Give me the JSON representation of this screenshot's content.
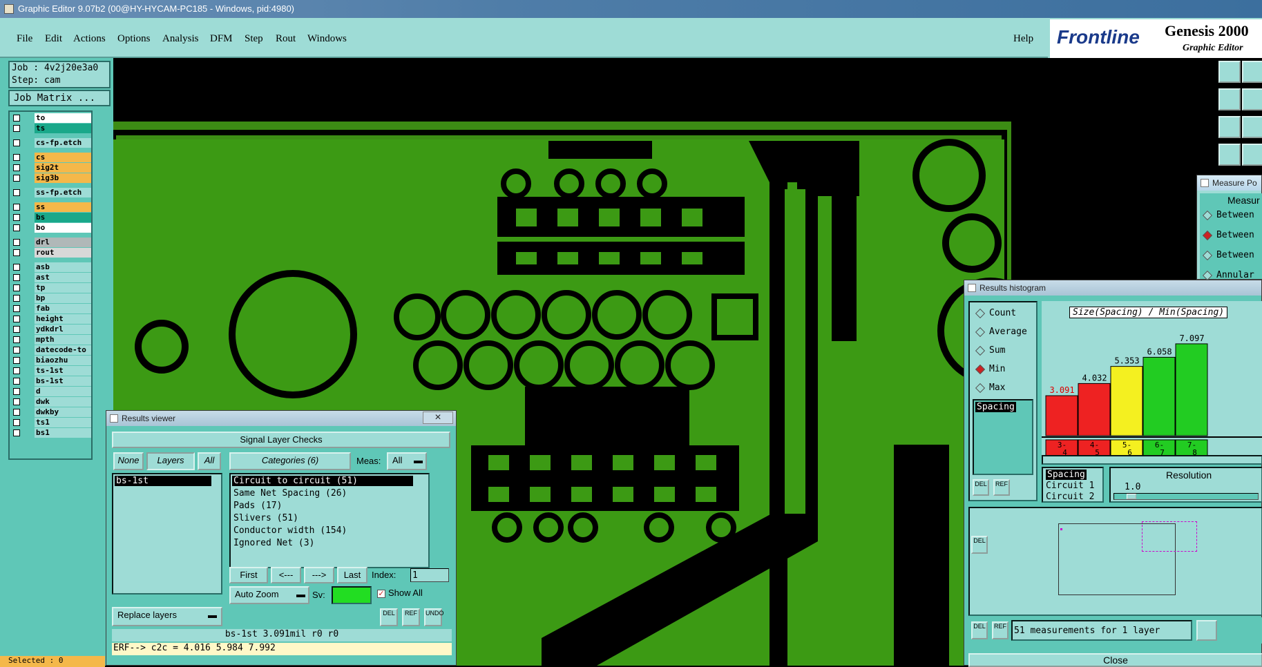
{
  "window_title": "Graphic Editor 9.07b2 (00@HY-HYCAM-PC185 - Windows, pid:4980)",
  "menu": [
    "File",
    "Edit",
    "Actions",
    "Options",
    "Analysis",
    "DFM",
    "Step",
    "Rout",
    "Windows"
  ],
  "help": "Help",
  "brand": {
    "logo": "Frontline",
    "product": "Genesis 2000",
    "subtitle": "Graphic Editor"
  },
  "job": {
    "job_line": "Job : 4v2j20e3a0",
    "step_line": "Step: cam",
    "matrix_button": "Job Matrix ..."
  },
  "layers": [
    {
      "name": "to",
      "color": "#ffffff"
    },
    {
      "name": "ts",
      "color": "#1aa88a"
    },
    {
      "name": "cs-fp.etch",
      "color": "#9edcd6"
    },
    {
      "name": "cs",
      "color": "#f4b84a"
    },
    {
      "name": "sig2t",
      "color": "#f4b84a"
    },
    {
      "name": "sig3b",
      "color": "#f4b84a"
    },
    {
      "name": "ss-fp.etch",
      "color": "#9edcd6"
    },
    {
      "name": "ss",
      "color": "#f4b84a"
    },
    {
      "name": "bs",
      "color": "#1aa88a"
    },
    {
      "name": "bo",
      "color": "#ffffff"
    },
    {
      "name": "drl",
      "color": "#b0b8b8"
    },
    {
      "name": "rout",
      "color": "#d8d8d8"
    },
    {
      "name": "asb",
      "color": "#9edcd6"
    },
    {
      "name": "ast",
      "color": "#9edcd6"
    },
    {
      "name": "tp",
      "color": "#9edcd6"
    },
    {
      "name": "bp",
      "color": "#9edcd6"
    },
    {
      "name": "fab",
      "color": "#9edcd6"
    },
    {
      "name": "height",
      "color": "#9edcd6"
    },
    {
      "name": "ydkdrl",
      "color": "#9edcd6"
    },
    {
      "name": "mpth",
      "color": "#9edcd6"
    },
    {
      "name": "datecode-to",
      "color": "#9edcd6"
    },
    {
      "name": "biaozhu",
      "color": "#9edcd6"
    },
    {
      "name": "ts-1st",
      "color": "#9edcd6"
    },
    {
      "name": "bs-1st",
      "color": "#9edcd6"
    },
    {
      "name": "d",
      "color": "#9edcd6"
    },
    {
      "name": "dwk",
      "color": "#9edcd6"
    },
    {
      "name": "dwkby",
      "color": "#9edcd6"
    },
    {
      "name": "ts1",
      "color": "#9edcd6"
    },
    {
      "name": "bs1",
      "color": "#9edcd6"
    }
  ],
  "selected_status": "Selected : 0",
  "results_viewer": {
    "title": "Results viewer",
    "header": "Signal Layer Checks",
    "none_btn": "None",
    "layers_btn": "Layers",
    "all_btn": "All",
    "layer_items": [
      "bs-1st"
    ],
    "categories_btn": "Categories (6)",
    "meas_label": "Meas:",
    "meas_value": "All",
    "categories": [
      "Circuit to circuit (51)",
      "Same Net Spacing (26)",
      "Pads (17)",
      "Slivers (51)",
      "Conductor width (154)",
      "Ignored Net (3)"
    ],
    "first_btn": "First",
    "prev_btn": "<---",
    "next_btn": "--->",
    "last_btn": "Last",
    "index_label": "Index:",
    "index_value": "1",
    "auto_zoom": "Auto Zoom",
    "sv_label": "Sv:",
    "show_all": "Show All",
    "replace_layers": "Replace layers",
    "status_line": "bs-1st 3.091mil  r0  r0",
    "erf_line": "ERF--> c2c = 4.016 5.984 7.992"
  },
  "histogram": {
    "title": "Results histogram",
    "options": [
      "Count",
      "Average",
      "Sum",
      "Min",
      "Max"
    ],
    "selected_option": "Min",
    "category_list": [
      "Spacing"
    ],
    "chart_title": "Size(Spacing) / Min(Spacing)",
    "data_list": [
      "Spacing",
      "Circuit 1",
      "Circuit 2"
    ],
    "resolution_label": "Resolution",
    "resolution_value": "1.0",
    "footer": "51 measurements for 1 layer",
    "close": "Close"
  },
  "chart_data": {
    "type": "bar",
    "categories": [
      "3-4",
      "4-5",
      "5-6",
      "6-7",
      "7-8"
    ],
    "values": [
      3.091,
      4.032,
      5.353,
      6.058,
      7.097
    ],
    "bar_colors": [
      "#ee2222",
      "#ee2222",
      "#f4f020",
      "#22cc22",
      "#22cc22"
    ],
    "title": "Size(Spacing) / Min(Spacing)"
  },
  "measure": {
    "title": "Measure Po",
    "header": "Measur",
    "options": [
      "Between",
      "Between",
      "Between",
      "Annular"
    ],
    "selected_index": 1
  }
}
